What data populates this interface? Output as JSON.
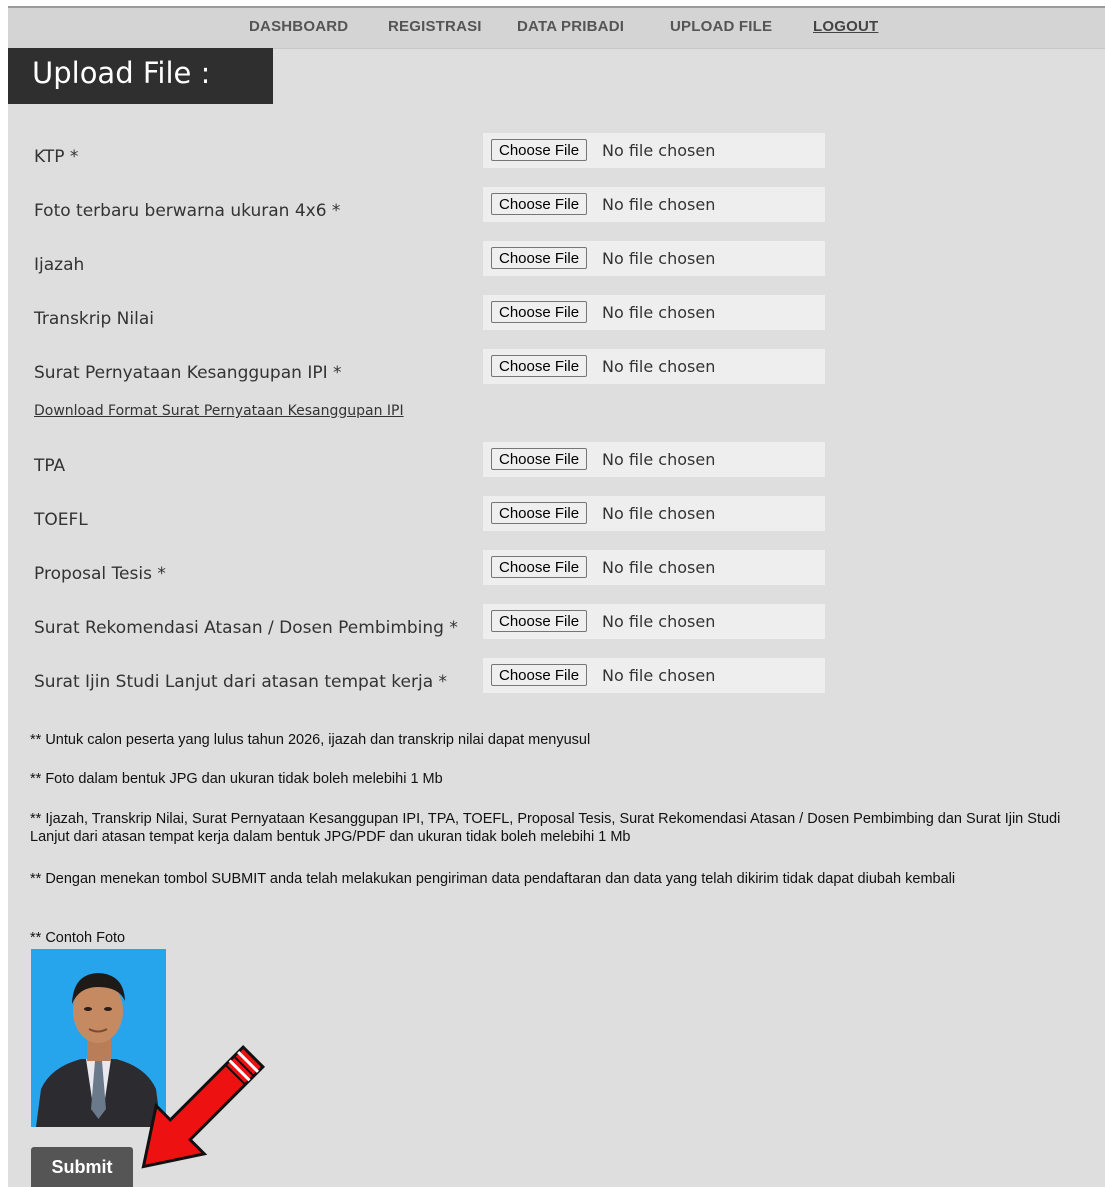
{
  "nav": {
    "items": [
      {
        "label": "DASHBOARD"
      },
      {
        "label": "REGISTRASI"
      },
      {
        "label": "DATA PRIBADI"
      },
      {
        "label": "UPLOAD FILE"
      },
      {
        "label": "LOGOUT"
      }
    ]
  },
  "page": {
    "title": "Upload File :"
  },
  "file_button_label": "Choose File",
  "file_status": "No file chosen",
  "fields": [
    {
      "label": "KTP *"
    },
    {
      "label": "Foto terbaru berwarna ukuran 4x6 *"
    },
    {
      "label": "Ijazah"
    },
    {
      "label": "Transkrip Nilai"
    },
    {
      "label": "Surat Pernyataan Kesanggupan IPI *"
    },
    {
      "label": "TPA"
    },
    {
      "label": "TOEFL"
    },
    {
      "label": "Proposal Tesis *"
    },
    {
      "label": "Surat Rekomendasi Atasan / Dosen Pembimbing *"
    },
    {
      "label": "Surat Ijin Studi Lanjut dari atasan tempat kerja *"
    }
  ],
  "download_link": "Download Format Surat Pernyataan Kesanggupan IPI",
  "notes": [
    "** Untuk calon peserta yang lulus tahun 2026, ijazah dan transkrip nilai dapat menyusul",
    "** Foto dalam bentuk JPG dan ukuran tidak boleh melebihi 1 Mb",
    "** Ijazah, Transkrip Nilai, Surat Pernyataan Kesanggupan IPI, TPA, TOEFL, Proposal Tesis, Surat Rekomendasi Atasan / Dosen Pembimbing dan Surat Ijin Studi Lanjut dari atasan tempat kerja dalam bentuk JPG/PDF dan ukuran tidak boleh melebihi 1 Mb",
    "** Dengan menekan tombol SUBMIT anda telah melakukan pengiriman data pendaftaran dan data yang telah dikirim tidak dapat diubah kembali",
    "** Contoh Foto"
  ],
  "submit_label": "Submit",
  "colors": {
    "accent_arrow": "#ee1111",
    "photo_background": "#27a5ec",
    "title_bar": "#2f2f2f"
  }
}
